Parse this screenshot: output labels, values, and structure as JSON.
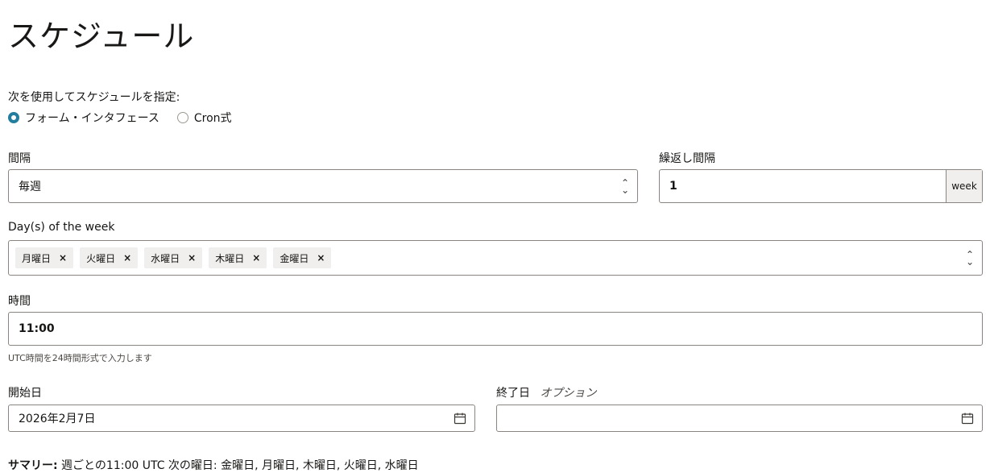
{
  "title": "スケジュール",
  "spec": {
    "label": "次を使用してスケジュールを指定:",
    "options": [
      {
        "label": "フォーム・インタフェース",
        "selected": true
      },
      {
        "label": "Cron式",
        "selected": false
      }
    ]
  },
  "interval": {
    "label": "間隔",
    "value": "毎週"
  },
  "repeat": {
    "label": "繰返し間隔",
    "value": "1",
    "unit": "week"
  },
  "days": {
    "label": "Day(s) of the week",
    "chips": [
      "月曜日",
      "火曜日",
      "水曜日",
      "木曜日",
      "金曜日"
    ],
    "remove_glyph": "×"
  },
  "time": {
    "label": "時間",
    "value": "11:00",
    "hint": "UTC時間を24時間形式で入力します"
  },
  "start": {
    "label": "開始日",
    "value": "2026年2月7日"
  },
  "end": {
    "label": "終了日",
    "optional": "オプション",
    "value": ""
  },
  "summary": {
    "prefix": "サマリー:",
    "text": " 週ごとの11:00 UTC 次の曜日: 金曜日, 月曜日, 木曜日, 火曜日, 水曜日"
  },
  "colors": {
    "accent": "#227e9e",
    "border": "#8a8580",
    "chip_bg": "#f1efed"
  }
}
